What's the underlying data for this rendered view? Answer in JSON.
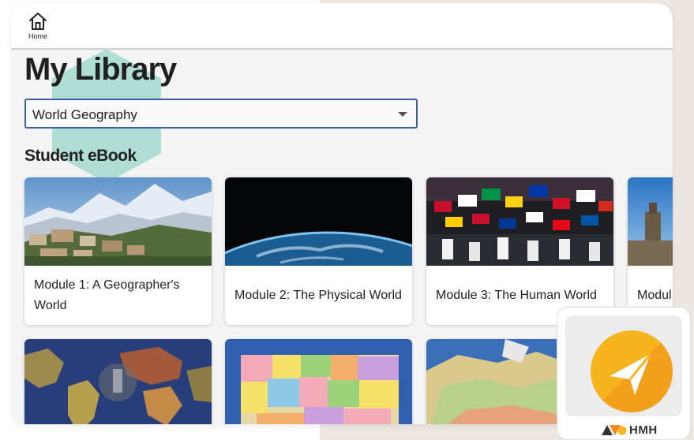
{
  "header": {
    "home_label": "Home"
  },
  "page": {
    "title": "My Library"
  },
  "book_select": {
    "selected": "World Geography"
  },
  "section": {
    "title": "Student eBook"
  },
  "modules": [
    {
      "title": "Module 1: A Geographer's World",
      "image": "mountain-village-photo"
    },
    {
      "title": "Module 2: The Physical World",
      "image": "earth-from-space-photo"
    },
    {
      "title": "Module 3: The Human World",
      "image": "parade-of-flags-photo"
    },
    {
      "title": "Modul Citizen",
      "image": "city-tower-photo"
    }
  ],
  "row2_images": [
    "historical-world-map",
    "us-political-map",
    "canada-map"
  ],
  "widget": {
    "brand": "HMH",
    "icon": "send-arrow-icon"
  },
  "colors": {
    "accent_blue": "#3d5ba9",
    "hex_teal": "#a8dcd2",
    "send_orange": "#f6b51e",
    "background": "#ece7e2"
  }
}
